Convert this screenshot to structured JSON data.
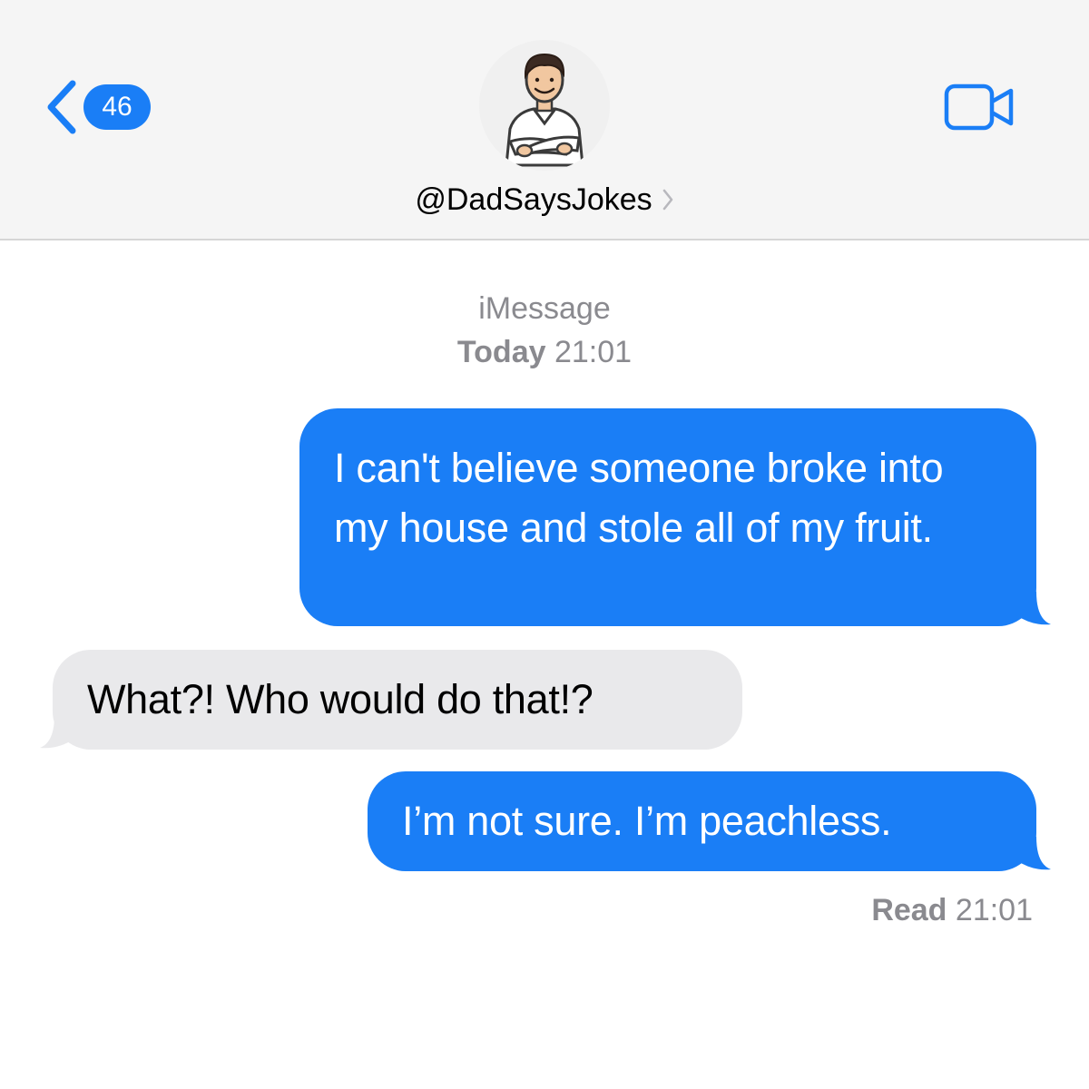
{
  "header": {
    "back_count": "46",
    "contact_name": "@DadSaysJokes"
  },
  "conversation": {
    "service": "iMessage",
    "date_label": "Today",
    "date_time": "21:01",
    "messages": [
      {
        "direction": "sent",
        "text": "I can't believe someone broke into my house and stole all of my fruit."
      },
      {
        "direction": "received",
        "text": "What?! Who would do that!?"
      },
      {
        "direction": "sent",
        "text": "I’m not sure. I’m peachless."
      }
    ],
    "read_label": "Read",
    "read_time": "21:01"
  },
  "colors": {
    "accent": "#1a7ef6",
    "received_bubble": "#e9e9eb",
    "meta_text": "#8a8a8f",
    "header_bg": "#f5f5f5"
  },
  "icons": [
    "back-chevron-icon",
    "chevron-right-icon",
    "video-camera-icon"
  ]
}
